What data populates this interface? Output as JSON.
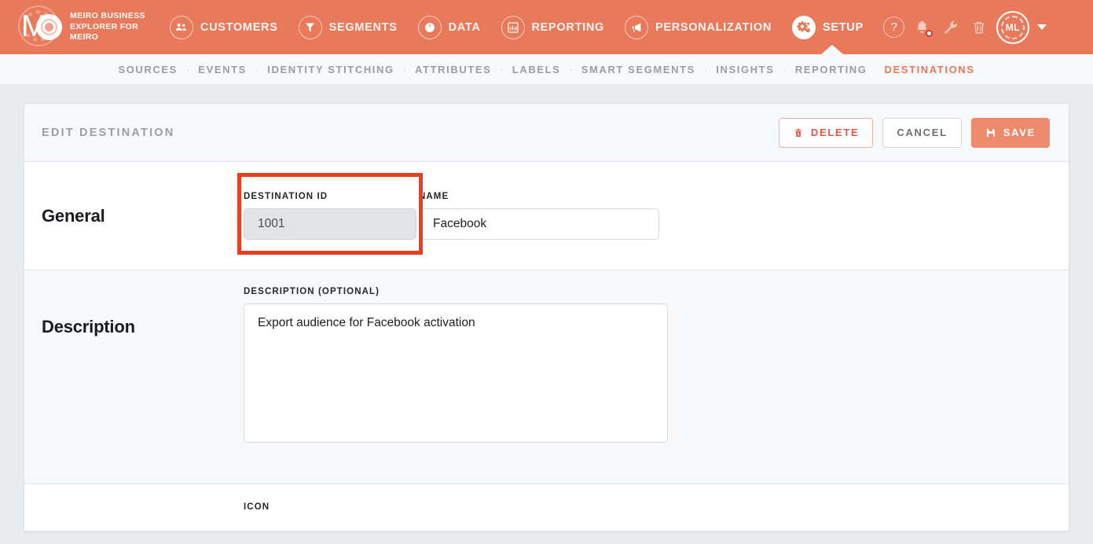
{
  "brand": {
    "line1": "MEIRO BUSINESS",
    "line2": "EXPLORER FOR",
    "line3": "MEIRO",
    "logo_icon": "meiro-logo-icon",
    "accent_color": "#e8795a"
  },
  "topnav": {
    "items": [
      {
        "label": "CUSTOMERS",
        "icon": "people-icon",
        "active": false
      },
      {
        "label": "SEGMENTS",
        "icon": "funnel-icon",
        "active": false
      },
      {
        "label": "DATA",
        "icon": "database-icon",
        "active": false
      },
      {
        "label": "REPORTING",
        "icon": "bar-chart-icon",
        "active": false
      },
      {
        "label": "PERSONALIZATION",
        "icon": "megaphone-icon",
        "active": false
      },
      {
        "label": "SETUP",
        "icon": "gears-icon",
        "active": true
      }
    ],
    "icons": [
      {
        "name": "help-icon",
        "glyph": "?"
      },
      {
        "name": "notifications-bell-icon",
        "badge": true
      },
      {
        "name": "wrench-icon"
      },
      {
        "name": "trash-icon"
      }
    ],
    "avatar": {
      "initials": "ML",
      "caret_icon": "chevron-down-icon"
    }
  },
  "subnav": {
    "separator": "·",
    "items": [
      {
        "label": "SOURCES",
        "active": false
      },
      {
        "label": "EVENTS",
        "active": false
      },
      {
        "label": "IDENTITY STITCHING",
        "active": false
      },
      {
        "label": "ATTRIBUTES",
        "active": false
      },
      {
        "label": "LABELS",
        "active": false
      },
      {
        "label": "SMART SEGMENTS",
        "active": false
      },
      {
        "label": "INSIGHTS",
        "active": false
      },
      {
        "label": "REPORTING",
        "active": false
      },
      {
        "label": "DESTINATIONS",
        "active": true
      }
    ]
  },
  "page": {
    "title": "EDIT DESTINATION",
    "actions": {
      "delete": {
        "label": "DELETE",
        "icon": "trash-icon"
      },
      "cancel": {
        "label": "CANCEL"
      },
      "save": {
        "label": "SAVE",
        "icon": "floppy-disk-icon"
      }
    },
    "sections": {
      "general": {
        "label": "General",
        "destination_id": {
          "label": "DESTINATION ID",
          "value": "1001",
          "readonly": true,
          "highlighted": true,
          "highlight_color": "#e8401f"
        },
        "name": {
          "label": "NAME",
          "value": "Facebook",
          "placeholder": ""
        }
      },
      "description": {
        "label": "Description",
        "textarea": {
          "label": "DESCRIPTION (OPTIONAL)",
          "value": "Export audience for Facebook activation",
          "placeholder": ""
        }
      },
      "icon": {
        "label": "ICON"
      }
    }
  }
}
